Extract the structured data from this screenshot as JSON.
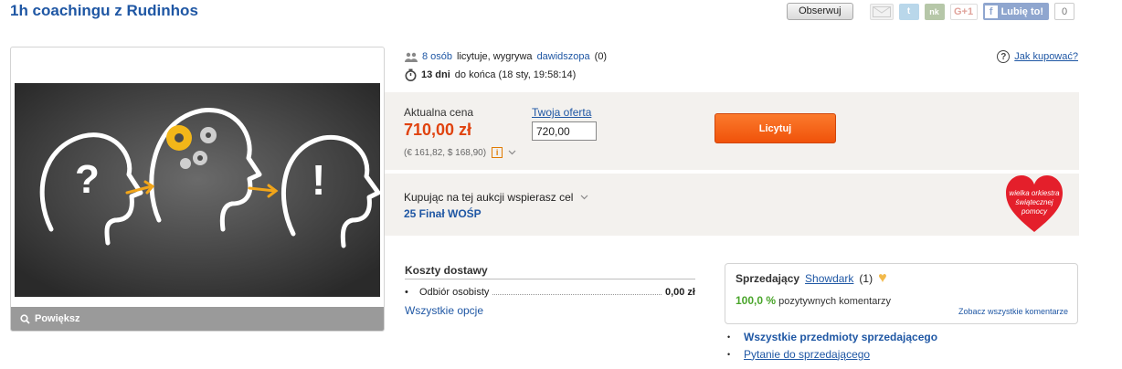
{
  "header": {
    "title": "1h coachingu z Rudinhos",
    "observe_label": "Obserwuj",
    "share": {
      "twitter_glyph": "t",
      "nk_glyph": "nk",
      "gplus_label": "G+1",
      "like_label": "Lubię to!",
      "like_count": "0"
    }
  },
  "gallery": {
    "zoom_label": "Powiększ",
    "zoom_icon": "magnifier-icon"
  },
  "auction": {
    "bidders_link": "8 osób",
    "bidders_text": "licytuje, wygrywa",
    "winner": "dawidszopa",
    "winner_score": "(0)",
    "days_left": "13 dni",
    "time_text": "do końca (18 sty, 19:58:14)",
    "how_to_buy": "Jak kupować?"
  },
  "price": {
    "current_label": "Aktualna cena",
    "current_value": "710,00 zł",
    "conversion": "(€ 161,82, $ 168,90)",
    "info_glyph": "i",
    "offer_label": "Twoja oferta",
    "offer_value": "720,00",
    "bid_button": "Licytuj",
    "accent": "#e0430f",
    "button_color": "#f0520a"
  },
  "charity": {
    "text": "Kupując na tej aukcji wspierasz cel",
    "name": "25 Finał WOŚP",
    "logo_lines": [
      "wielka orkiestra",
      "świątecznej",
      "pomocy"
    ],
    "logo_color": "#e41f2b"
  },
  "shipping": {
    "heading": "Koszty dostawy",
    "rows": [
      {
        "bullet": "•",
        "label": "Odbiór osobisty",
        "amount": "0,00 zł"
      }
    ],
    "all_options": "Wszystkie opcje"
  },
  "seller": {
    "label": "Sprzedający",
    "name": "Showdark",
    "score": "(1)",
    "positive_pct": "100,0 %",
    "positive_text": "pozytywnych komentarzy",
    "all_comments": "Zobacz wszystkie komentarze",
    "links": [
      {
        "label": "Wszystkie przedmioty sprzedającego"
      },
      {
        "label": "Pytanie do sprzedającego"
      }
    ]
  }
}
